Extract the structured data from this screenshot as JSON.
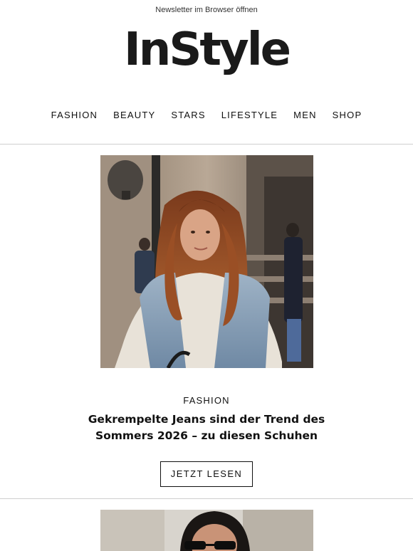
{
  "header": {
    "browser_link": "Newsletter im Browser öffnen",
    "logo": "InStyle"
  },
  "nav": {
    "items": [
      {
        "label": "FASHION"
      },
      {
        "label": "BEAUTY"
      },
      {
        "label": "STARS"
      },
      {
        "label": "LIFESTYLE"
      },
      {
        "label": "MEN"
      },
      {
        "label": "SHOP"
      }
    ]
  },
  "article": {
    "category": "FASHION",
    "headline_line1": "Gekrempelte Jeans sind der Trend des",
    "headline_line2": "Sommers 2026 – zu diesen Schuhen",
    "cta_label": "JETZT LESEN"
  },
  "colors": {
    "text": "#111111",
    "divider": "#cfcfcf",
    "background": "#ffffff"
  }
}
